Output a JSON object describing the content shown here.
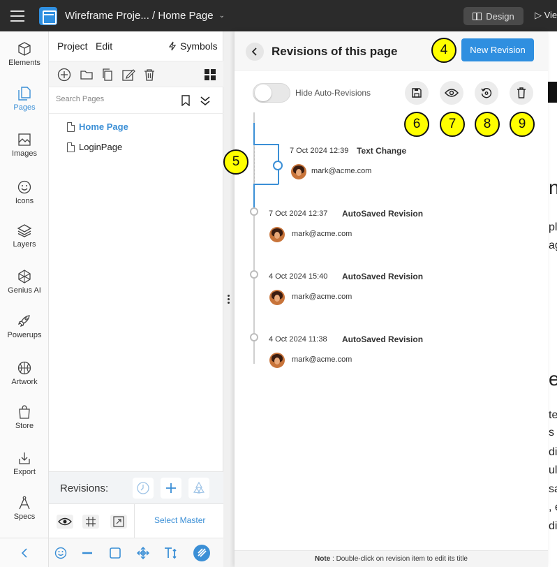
{
  "topbar": {
    "title": "Wireframe Proje... / Home Page",
    "caret": "⌄",
    "design_label": "Design",
    "view_label": "▷ Vie"
  },
  "rail": {
    "items": [
      {
        "label": "Elements"
      },
      {
        "label": "Pages"
      },
      {
        "label": "Images"
      },
      {
        "label": "Icons"
      },
      {
        "label": "Layers"
      },
      {
        "label": "Genius AI"
      },
      {
        "label": "Powerups"
      },
      {
        "label": "Artwork"
      },
      {
        "label": "Store"
      },
      {
        "label": "Export"
      },
      {
        "label": "Specs"
      }
    ],
    "active_color": "#3b8fd6"
  },
  "pages_panel": {
    "menu_project": "Project",
    "menu_edit": "Edit",
    "symbols": "Symbols",
    "search_placeholder": "Search Pages",
    "pages": [
      {
        "label": "Home Page",
        "active": true
      },
      {
        "label": "LoginPage",
        "active": false
      }
    ],
    "revisions_label": "Revisions:",
    "select_master": "Select Master"
  },
  "revisions": {
    "title": "Revisions of this page",
    "new_revision": "New Revision",
    "hide_auto": "Hide Auto-Revisions",
    "items": [
      {
        "date": "7 Oct 2024 12:39",
        "name": "Text Change",
        "email": "mark@acme.com"
      },
      {
        "date": "7 Oct 2024 12:37",
        "name": "AutoSaved Revision",
        "email": "mark@acme.com"
      },
      {
        "date": "4 Oct 2024 15:40",
        "name": "AutoSaved Revision",
        "email": "mark@acme.com"
      },
      {
        "date": "4 Oct 2024 11:38",
        "name": "AutoSaved Revision",
        "email": "mark@acme.com"
      }
    ],
    "note_prefix": "Note",
    "note_text": " : Double-click on revision item to edit its title",
    "accent": "#2f8fe0"
  },
  "callouts": [
    "4",
    "5",
    "6",
    "7",
    "8",
    "9"
  ],
  "canvas_fragments": [
    "n",
    "plo",
    "ag",
    "e",
    "te",
    "s d",
    "dip",
    "ul",
    "sa",
    ", e",
    "die"
  ]
}
